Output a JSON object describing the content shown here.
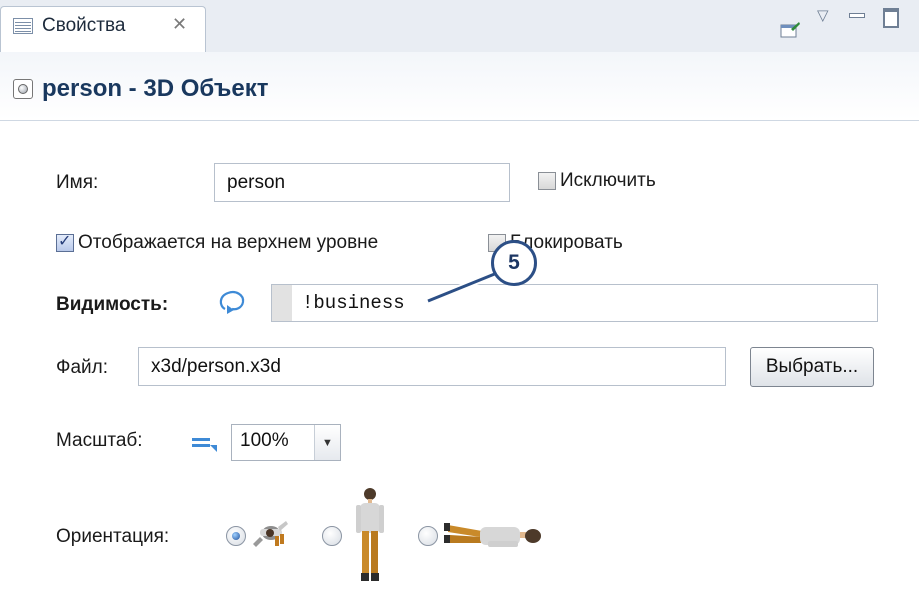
{
  "tab": {
    "label": "Свойства",
    "close_icon": "close-icon"
  },
  "toolbar": {
    "icons": [
      "pin-icon",
      "view-menu-icon",
      "minimize-icon",
      "maximize-icon"
    ]
  },
  "header": {
    "title": "person - 3D Объект",
    "icon": "3d-object-icon"
  },
  "form": {
    "name_label": "Имя:",
    "name_value": "person",
    "exclude_label": "Исключить",
    "exclude_checked": false,
    "top_level_label": "Отображается на верхнем уровне",
    "top_level_checked": true,
    "lock_label": "Блокировать",
    "lock_checked": false,
    "visibility_label": "Видимость:",
    "visibility_value": "!business",
    "file_label": "Файл:",
    "file_value": "x3d/person.x3d",
    "browse_label": "Выбрать...",
    "scale_label": "Масштаб:",
    "scale_value": "100%",
    "orientation_label": "Ориентация:",
    "orientation_options": [
      "top-view",
      "standing",
      "lying"
    ],
    "orientation_selected": "top-view"
  },
  "callout": {
    "number": "5"
  },
  "colors": {
    "title": "#19385e",
    "callout_border": "#2c4f86",
    "tab_bar": "#e9edf3"
  }
}
